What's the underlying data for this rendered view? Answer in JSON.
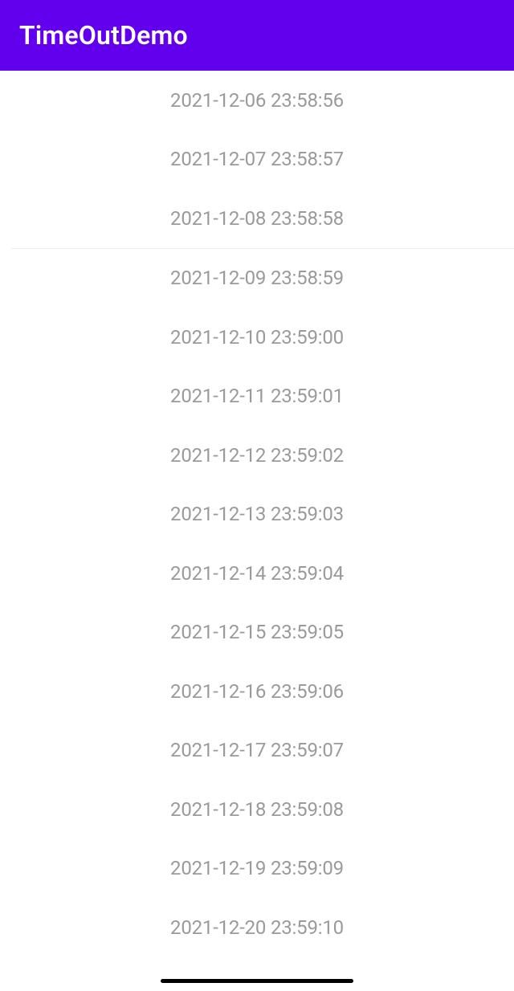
{
  "header": {
    "title": "TimeOutDemo"
  },
  "list": {
    "items": [
      {
        "text": "2021-12-06 23:58:56"
      },
      {
        "text": "2021-12-07 23:58:57"
      },
      {
        "text": "2021-12-08 23:58:58"
      },
      {
        "text": "2021-12-09 23:58:59"
      },
      {
        "text": "2021-12-10 23:59:00"
      },
      {
        "text": "2021-12-11 23:59:01"
      },
      {
        "text": "2021-12-12 23:59:02"
      },
      {
        "text": "2021-12-13 23:59:03"
      },
      {
        "text": "2021-12-14 23:59:04"
      },
      {
        "text": "2021-12-15 23:59:05"
      },
      {
        "text": "2021-12-16 23:59:06"
      },
      {
        "text": "2021-12-17 23:59:07"
      },
      {
        "text": "2021-12-18 23:59:08"
      },
      {
        "text": "2021-12-19 23:59:09"
      },
      {
        "text": "2021-12-20 23:59:10"
      }
    ],
    "dividerAfterIndex": 2
  }
}
